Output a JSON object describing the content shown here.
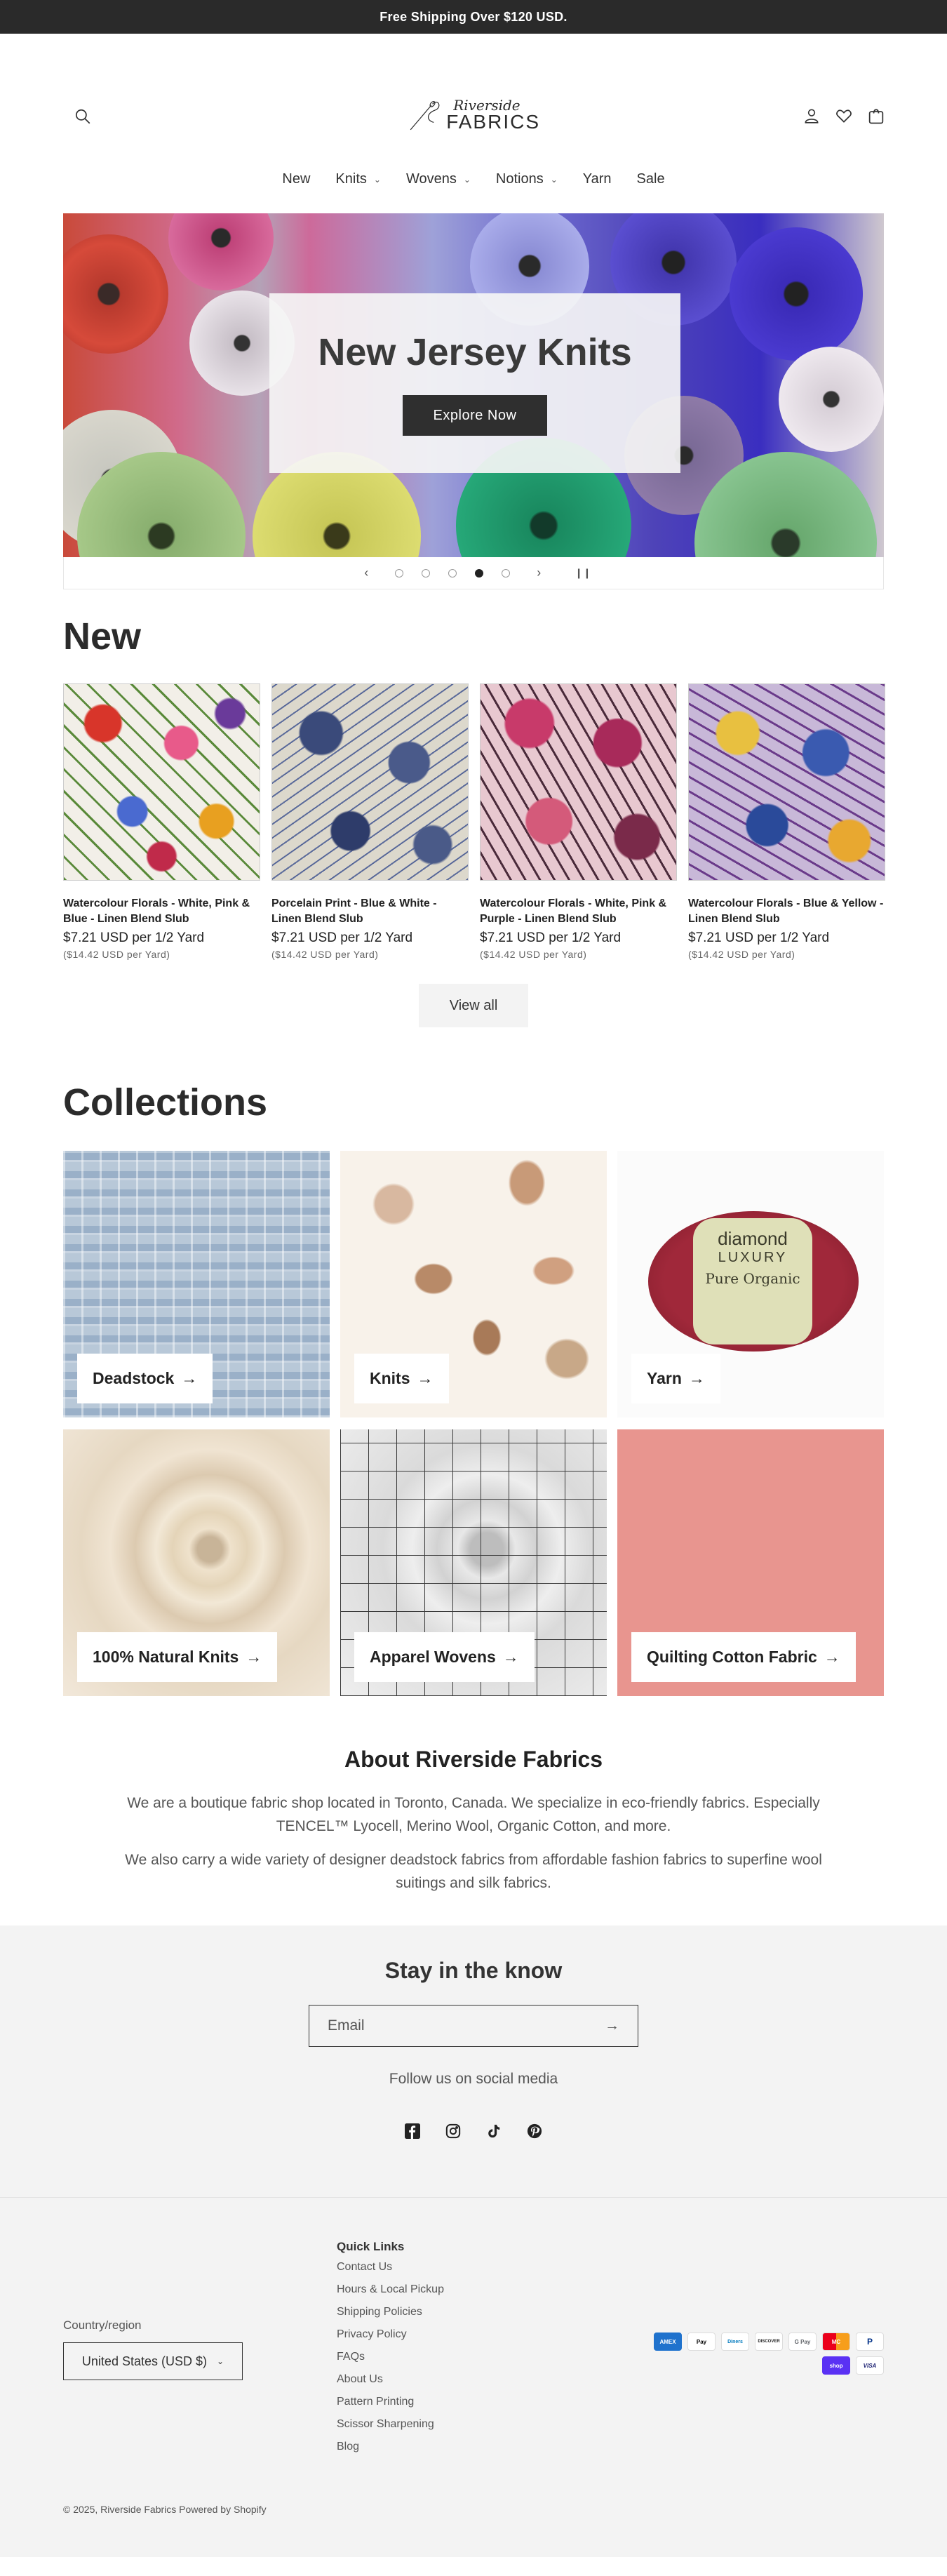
{
  "announcement": "Free Shipping Over $120 USD.",
  "logo": {
    "script": "Riverside",
    "word": "FABRICS"
  },
  "nav": [
    {
      "label": "New",
      "dropdown": false
    },
    {
      "label": "Knits",
      "dropdown": true
    },
    {
      "label": "Wovens",
      "dropdown": true
    },
    {
      "label": "Notions",
      "dropdown": true
    },
    {
      "label": "Yarn",
      "dropdown": false
    },
    {
      "label": "Sale",
      "dropdown": false
    }
  ],
  "hero": {
    "title": "New Jersey Knits",
    "button": "Explore Now",
    "active_slide": 4,
    "slide_count": 5
  },
  "new_section": {
    "title": "New",
    "products": [
      {
        "name": "Watercolour Florals - White, Pink & Blue - Linen Blend Slub",
        "price": "$7.21 USD per 1/2 Yard",
        "sub": "($14.42 USD per Yard)"
      },
      {
        "name": "Porcelain Print - Blue & White - Linen Blend Slub",
        "price": "$7.21 USD per 1/2 Yard",
        "sub": "($14.42 USD per Yard)"
      },
      {
        "name": "Watercolour Florals - White, Pink & Purple - Linen Blend Slub",
        "price": "$7.21 USD per 1/2 Yard",
        "sub": "($14.42 USD per Yard)"
      },
      {
        "name": "Watercolour Florals - Blue & Yellow - Linen Blend Slub",
        "price": "$7.21 USD per 1/2 Yard",
        "sub": "($14.42 USD per Yard)"
      }
    ],
    "view_all": "View all"
  },
  "collections": {
    "title": "Collections",
    "items": [
      {
        "label": "Deadstock"
      },
      {
        "label": "Knits"
      },
      {
        "label": "Yarn"
      },
      {
        "label": "100% Natural Knits"
      },
      {
        "label": "Apparel Wovens"
      },
      {
        "label": "Quilting Cotton Fabric"
      }
    ],
    "yarn_band": {
      "brand": "diamond",
      "line": "LUXURY",
      "name": "Pure Organic"
    }
  },
  "about": {
    "title": "About Riverside Fabrics",
    "p1": "We are a boutique fabric shop located in Toronto, Canada. We specialize in eco-friendly fabrics. Especially TENCEL™ Lyocell, Merino Wool, Organic Cotton, and more.",
    "p2": "We also carry a wide variety of designer deadstock fabrics from affordable fashion fabrics to superfine wool suitings and silk fabrics."
  },
  "newsletter": {
    "title": "Stay in the know",
    "email_placeholder": "Email",
    "follow": "Follow us on social media"
  },
  "footer": {
    "quick_title": "Quick Links",
    "links": [
      "Contact Us",
      "Hours & Local Pickup",
      "Shipping Policies",
      "Privacy Policy",
      "FAQs",
      "About Us",
      "Pattern Printing",
      "Scissor Sharpening",
      "Blog"
    ],
    "country_label": "Country/region",
    "country_value": "United States (USD $)",
    "payments": [
      "AMEX",
      "Pay",
      "Diners",
      "DISCOVER",
      "G Pay",
      "MC",
      "P",
      "shop",
      "VISA"
    ],
    "copyright": "© 2025, Riverside Fabrics Powered by Shopify"
  },
  "colors": {
    "announcement_bg": "#2a2a2a",
    "button_dark": "#2f2f2f",
    "quilting": "#e8958f",
    "soft_bg": "#f3f3f3"
  }
}
